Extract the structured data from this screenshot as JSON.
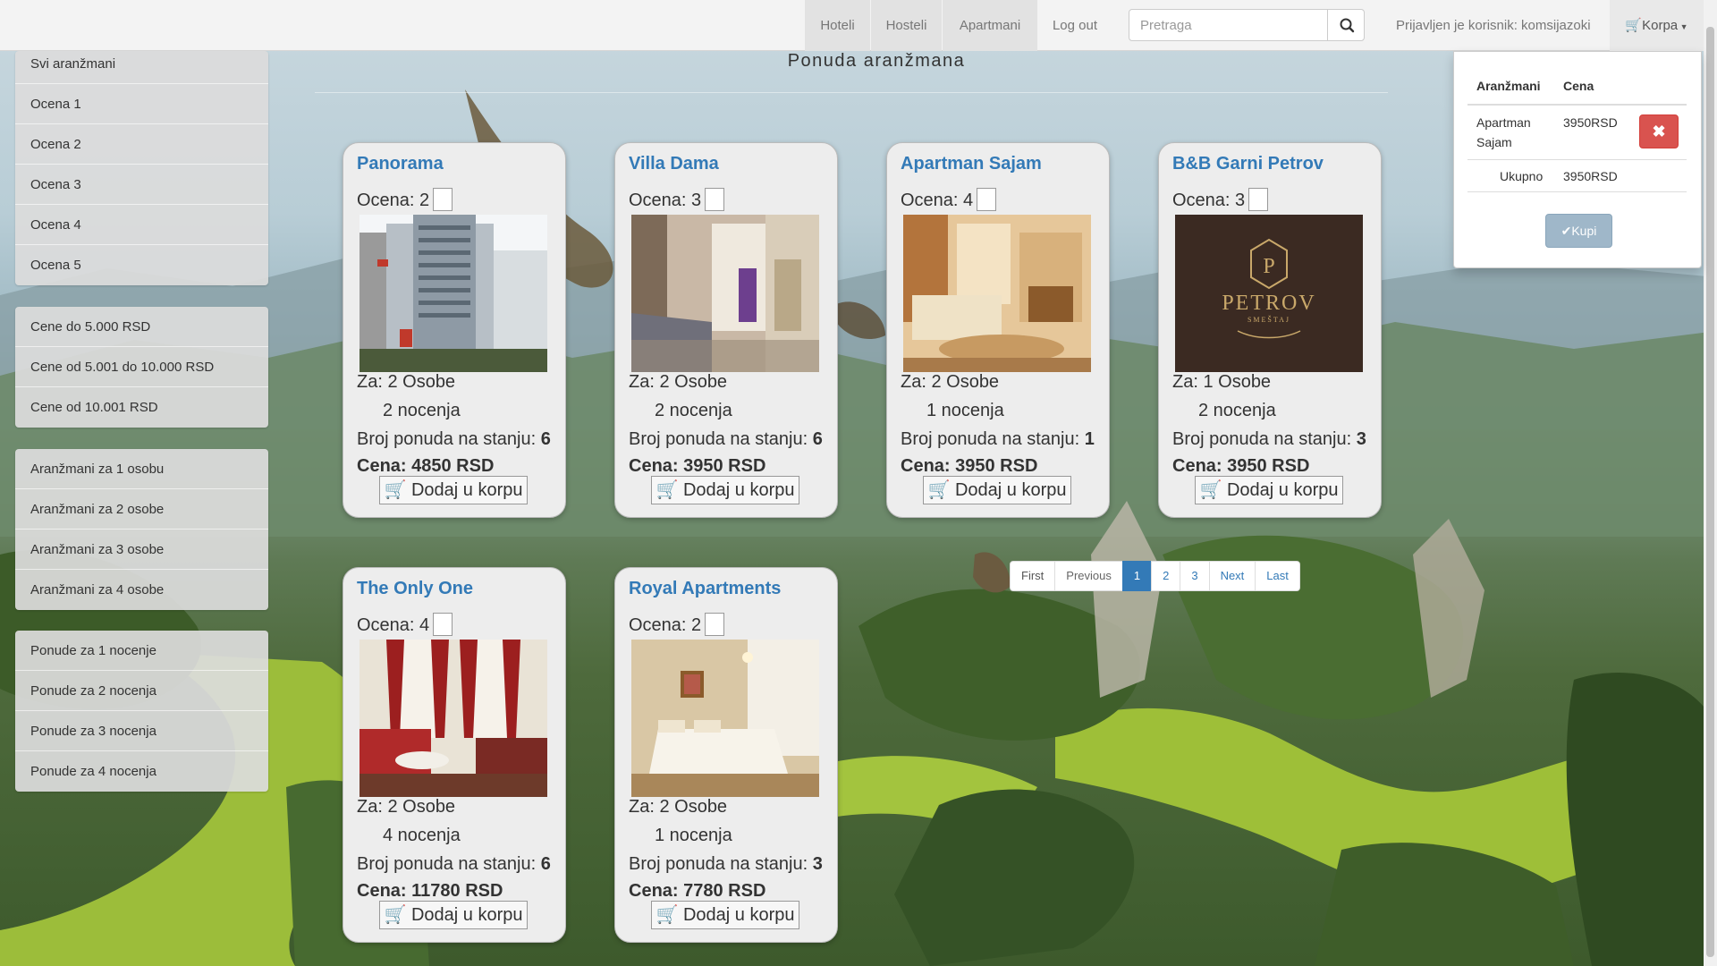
{
  "nav": {
    "tabs": [
      {
        "label": "Hoteli"
      },
      {
        "label": "Hosteli"
      },
      {
        "label": "Apartmani"
      },
      {
        "label": "Log out"
      }
    ],
    "search_placeholder": "Pretraga",
    "logged_in_text": "Prijavljen je korisnik: komsijazoki",
    "cart_label": "Korpa"
  },
  "sidebar": {
    "ratings": [
      "Svi aranžmani",
      "Ocena 1",
      "Ocena 2",
      "Ocena 3",
      "Ocena 4",
      "Ocena 5"
    ],
    "prices": [
      "Cene do 5.000 RSD",
      "Cene od 5.001 do 10.000 RSD",
      "Cene od 10.001 RSD"
    ],
    "persons": [
      "Aranžmani za 1 osobu",
      "Aranžmani za 2 osobe",
      "Aranžmani za 3 osobe",
      "Aranžmani za 4 osobe"
    ],
    "nights": [
      "Ponude za 1 nocenje",
      "Ponude za 2 nocenja",
      "Ponude za 3 nocenja",
      "Ponude za 4 nocenja"
    ]
  },
  "main": {
    "title": "Ponuda aranžmana",
    "button_label": "Dodaj u korpu",
    "cards": [
      {
        "name": "Panorama",
        "rating_label": "Ocena: 2",
        "persons": "Za: 2 Osobe",
        "nights": "2 nocenja",
        "stock_label": "Broj ponuda na stanju:",
        "stock": "6",
        "price": "Cena: 4850 RSD",
        "image": "hotel-building-photo"
      },
      {
        "name": "Villa Dama",
        "rating_label": "Ocena: 3",
        "persons": "Za: 2 Osobe",
        "nights": "2 nocenja",
        "stock_label": "Broj ponuda na stanju:",
        "stock": "6",
        "price": "Cena: 3950 RSD",
        "image": "apartment-interior-photo"
      },
      {
        "name": "Apartman Sajam",
        "rating_label": "Ocena: 4",
        "persons": "Za: 2 Osobe",
        "nights": "1 nocenja",
        "stock_label": "Broj ponuda na stanju:",
        "stock": "1",
        "price": "Cena: 3950 RSD",
        "image": "living-room-photo"
      },
      {
        "name": "B&B Garni Petrov",
        "rating_label": "Ocena: 3",
        "persons": "Za: 1 Osobe",
        "nights": "2 nocenja",
        "stock_label": "Broj ponuda na stanju:",
        "stock": "3",
        "price": "Cena: 3950 RSD",
        "image": "petrov-logo",
        "logo_letter": "P",
        "logo_text": "PETROV",
        "logo_sub": "SMEŠTAJ"
      },
      {
        "name": "The Only One",
        "rating_label": "Ocena: 4",
        "persons": "Za: 2 Osobe",
        "nights": "4 nocenja",
        "stock_label": "Broj ponuda na stanju:",
        "stock": "6",
        "price": "Cena: 11780 RSD",
        "image": "bedroom-red-curtains-photo"
      },
      {
        "name": "Royal Apartments",
        "rating_label": "Ocena: 2",
        "persons": "Za: 2 Osobe",
        "nights": "1 nocenja",
        "stock_label": "Broj ponuda na stanju:",
        "stock": "3",
        "price": "Cena: 7780 RSD",
        "image": "bedroom-photo"
      }
    ]
  },
  "pagination": [
    "First",
    "Previous",
    "1",
    "2",
    "3",
    "Next",
    "Last"
  ],
  "pagination_active": "1",
  "cart": {
    "col_item": "Aranžmani",
    "col_price": "Cena",
    "item_line1": "Apartman",
    "item_line2": "Sajam",
    "item_price": "3950RSD",
    "total_label": "Ukupno",
    "total_value": "3950RSD",
    "buy_label": "Kupi"
  },
  "colors": {
    "link": "#337ab7",
    "danger": "#d9534f",
    "buy": "#9fb7c9"
  }
}
